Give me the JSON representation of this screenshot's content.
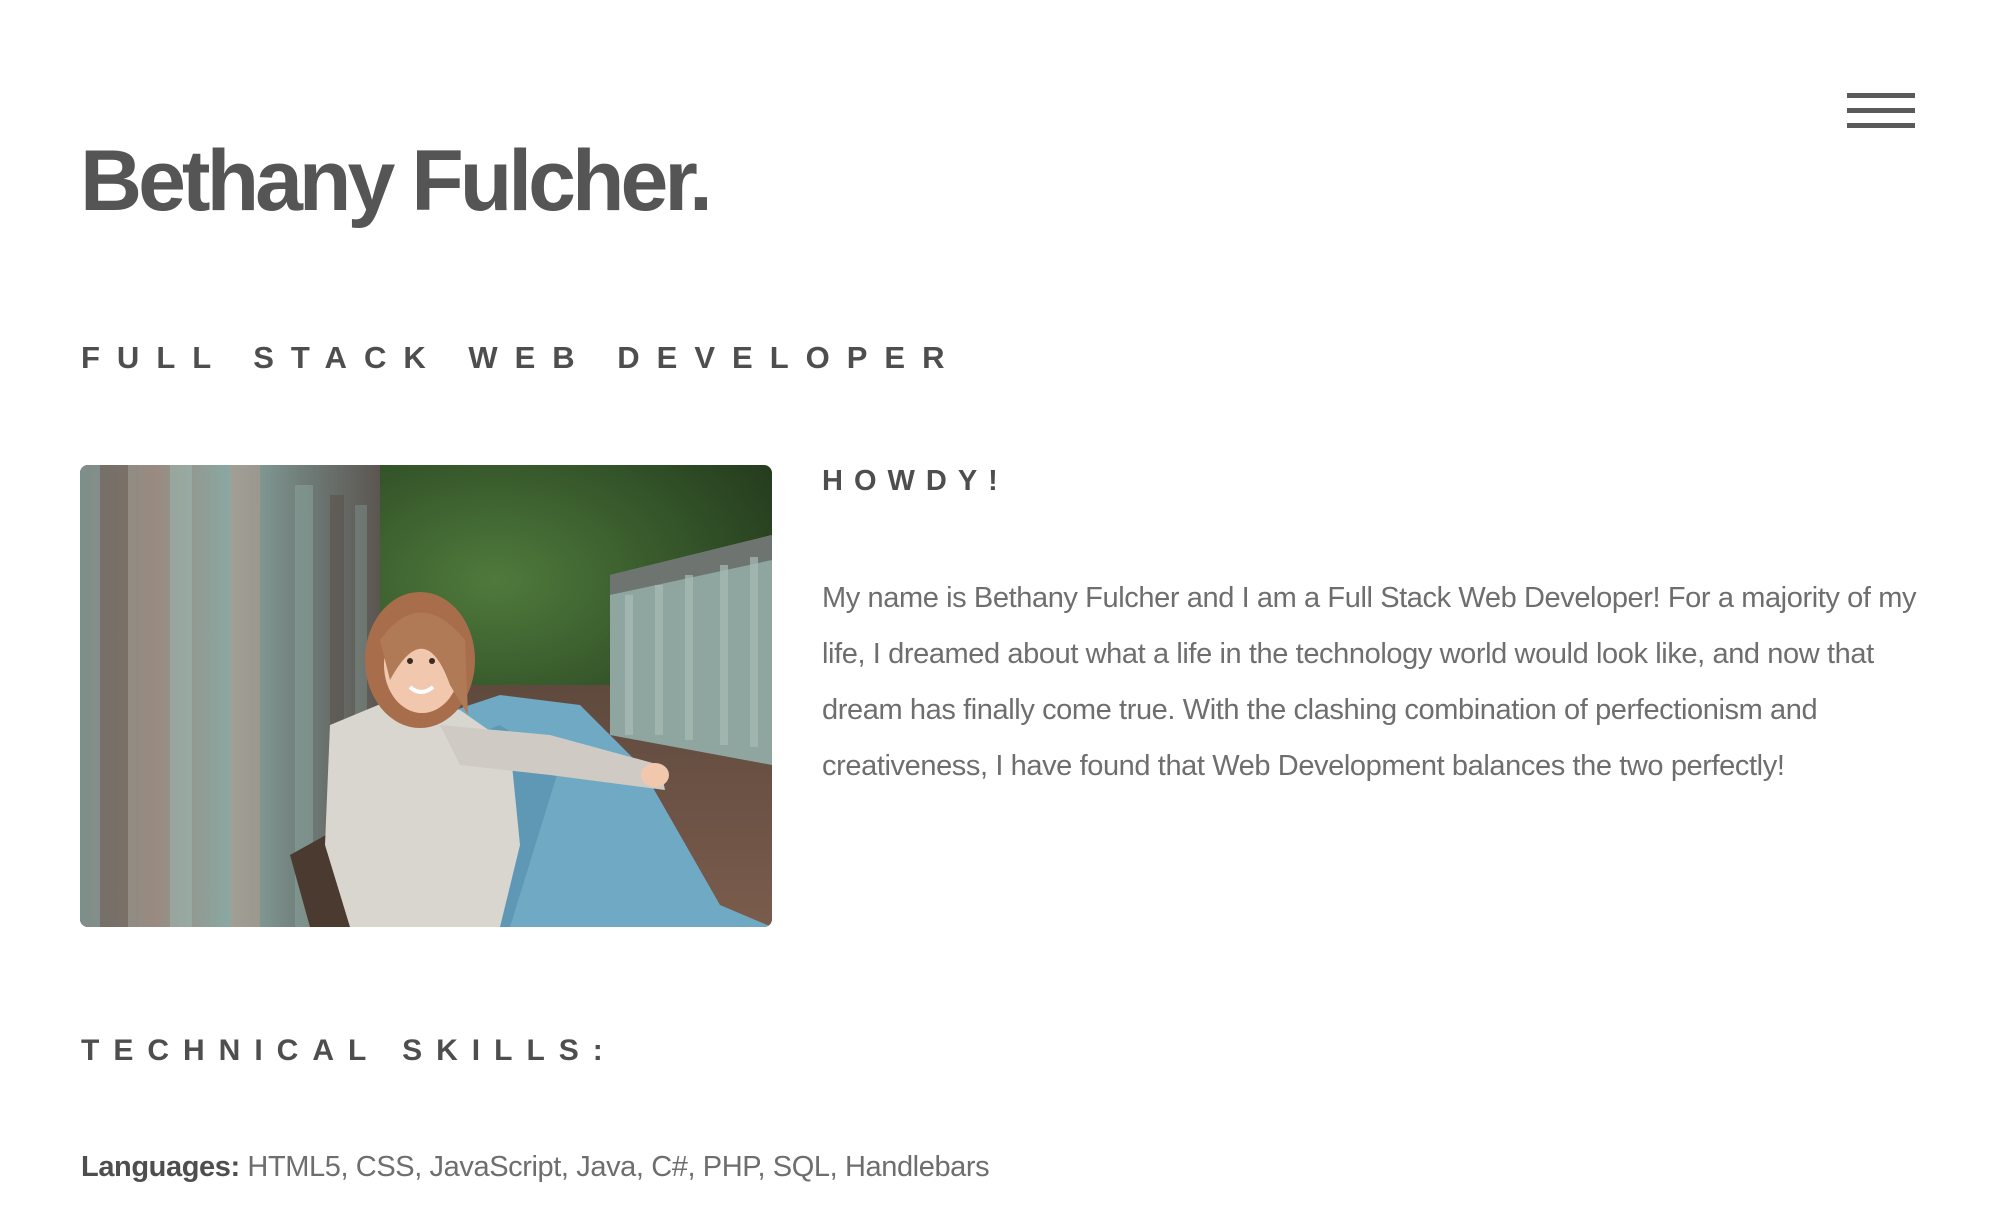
{
  "header": {
    "title": "Bethany Fulcher.",
    "menu_icon": "hamburger-menu-icon"
  },
  "hero": {
    "subtitle": "FULL STACK WEB DEVELOPER"
  },
  "about": {
    "photo_alt": "Photo of Bethany Fulcher",
    "heading": "HOWDY!",
    "bio": "My name is Bethany Fulcher and I am a Full Stack Web Developer! For a majority of my life, I dreamed about what a life in the technology world would look like, and now that dream has finally come true. With the clashing combination of perfectionism and creativeness, I have found that Web Development balances the two perfectly!"
  },
  "skills": {
    "heading": "TECHNICAL SKILLS:",
    "languages_label": "Languages:",
    "languages_value": "HTML5, CSS, JavaScript, Java, C#, PHP, SQL, Handlebars"
  },
  "colors": {
    "text_dark": "#4e4e4e",
    "text_body": "#6e6e6e",
    "background": "#ffffff"
  }
}
